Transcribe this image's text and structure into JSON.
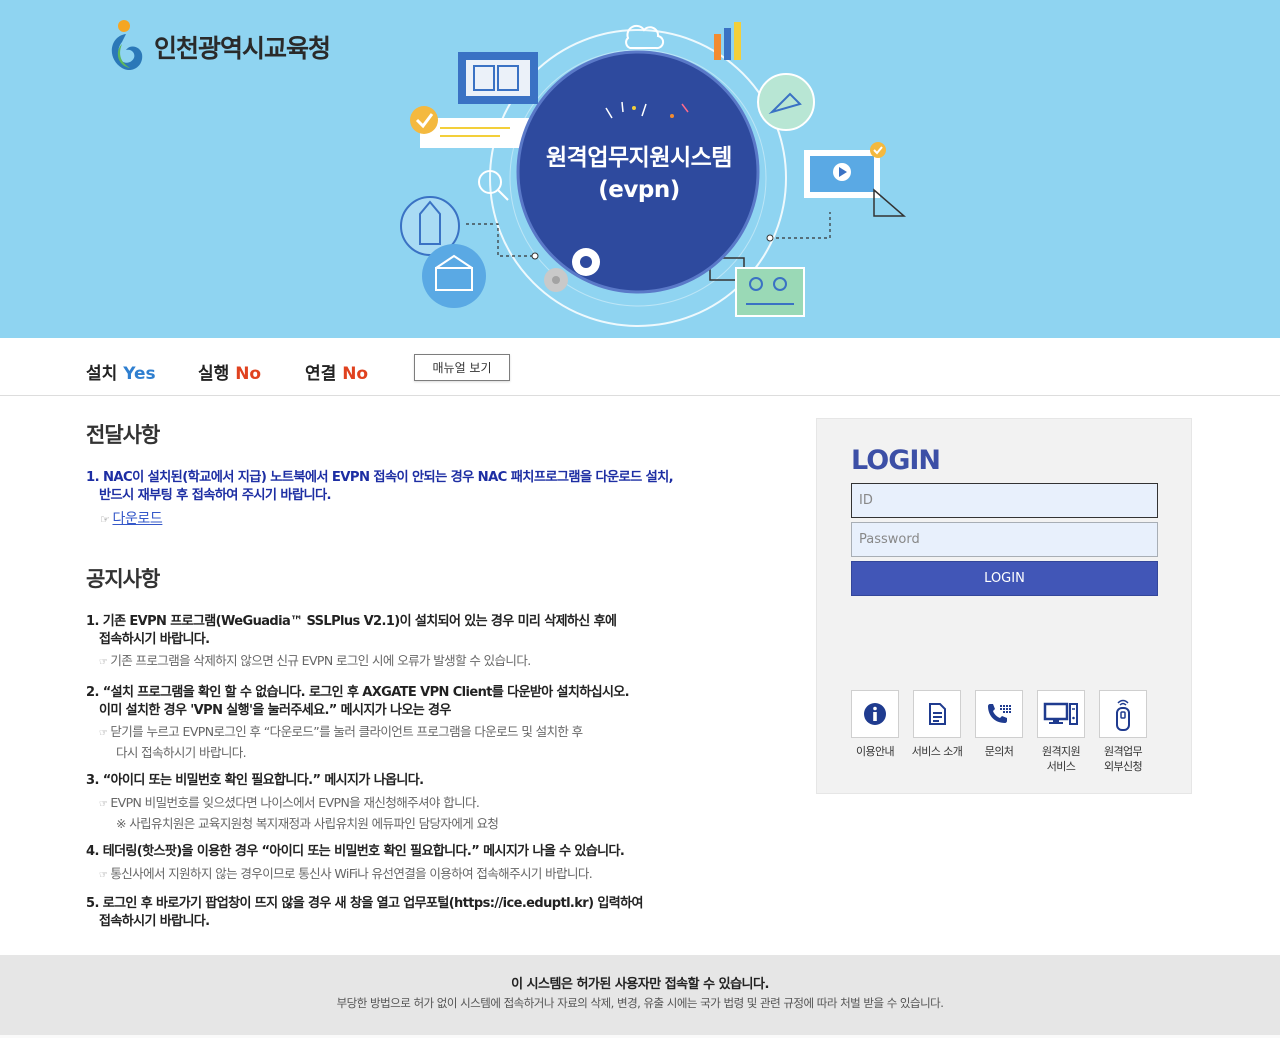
{
  "header": {
    "logo_text": "인천광역시교육청",
    "hero_title_line1": "원격업무지원시스템",
    "hero_title_line2": "(evpn)"
  },
  "status": {
    "install_label": "설치",
    "install_value": "Yes",
    "run_label": "실행",
    "run_value": "No",
    "connect_label": "연결",
    "connect_value": "No",
    "manual_button": "매뉴얼 보기"
  },
  "deliver": {
    "title": "전달사항",
    "line1": "1. NAC이 설치된(학교에서 지급) 노트북에서 EVPN 접속이 안되는 경우 NAC 패치프로그램을 다운로드 설치,",
    "line2": "반드시 재부팅 후 접속하여 주시기 바랍니다.",
    "hand": "☞",
    "download_link": "다운로드"
  },
  "notices": {
    "title": "공지사항",
    "hand": "☞",
    "n1_line1": "1. 기존 EVPN 프로그램(WeGuadia™ SSLPlus V2.1)이 설치되어 있는 경우 미리 삭제하신 후에",
    "n1_line2": "접속하시기 바랍니다.",
    "n1_sub": "기존 프로그램을 삭제하지 않으면 신규 EVPN 로그인 시에 오류가 발생할 수 있습니다.",
    "n2_line1": "2. “설치 프로그램을 확인 할 수 없습니다. 로그인 후 AXGATE VPN Client를 다운받아 설치하십시오.",
    "n2_line2": "이미 설치한 경우 'VPN 실행'을 눌러주세요.” 메시지가 나오는 경우",
    "n2_sub1": "닫기를 누르고 EVPN로그인 후 “다운로드”를 눌러 클라이언트 프로그램을 다운로드 및 설치한 후",
    "n2_sub2": "다시 접속하시기 바랍니다.",
    "n3_line1": "3. “아이디 또는 비밀번호 확인 필요합니다.” 메시지가 나옵니다.",
    "n3_sub1": "EVPN 비밀번호를 잊으셨다면 나이스에서 EVPN을 재신청해주셔야 합니다.",
    "n3_sub2": "※ 사립유치원은 교육지원청 복지재정과 사립유치원 에듀파인 담당자에게 요청",
    "n4_line1": "4. 테더링(핫스팟)을 이용한 경우 “아이디 또는 비밀번호 확인 필요합니다.” 메시지가 나올 수 있습니다.",
    "n4_sub": "통신사에서 지원하지 않는 경우이므로 통신사 WiFi나 유선연결을 이용하여 접속해주시기 바랍니다.",
    "n5_line1": "5. 로그인 후 바로가기 팝업창이 뜨지 않을 경우 새 창을 열고 업무포털(https://ice.eduptl.kr) 입력하여",
    "n5_line2": "접속하시기 바랍니다."
  },
  "login": {
    "title": "LOGIN",
    "id_placeholder": "ID",
    "pw_placeholder": "Password",
    "button": "LOGIN",
    "services": [
      {
        "label": "이용안내",
        "icon": "info-icon"
      },
      {
        "label": "서비스 소개",
        "icon": "document-icon"
      },
      {
        "label": "문의처",
        "icon": "phone-icon"
      },
      {
        "label_line1": "원격지원",
        "label_line2": "서비스",
        "icon": "computer-icon"
      },
      {
        "label_line1": "원격업무",
        "label_line2": "외부신청",
        "icon": "usb-key-icon"
      }
    ]
  },
  "footer": {
    "main": "이 시스템은 허가된 사용자만 접속할 수 있습니다.",
    "sub": "부당한 방법으로 허가 없이 시스템에 접속하거나 자료의 삭제, 변경, 유출 시에는 국가 법령 및 관련 규정에 따라 처벌 받을 수 있습니다."
  },
  "colors": {
    "hero_bg": "#8fd4f1",
    "circle": "#2e4a9e",
    "yes": "#2f7fd0",
    "no": "#e0421f",
    "login_title": "#3c4fa6",
    "login_button": "#4156b7",
    "deliver_text": "#1d2ea3"
  }
}
